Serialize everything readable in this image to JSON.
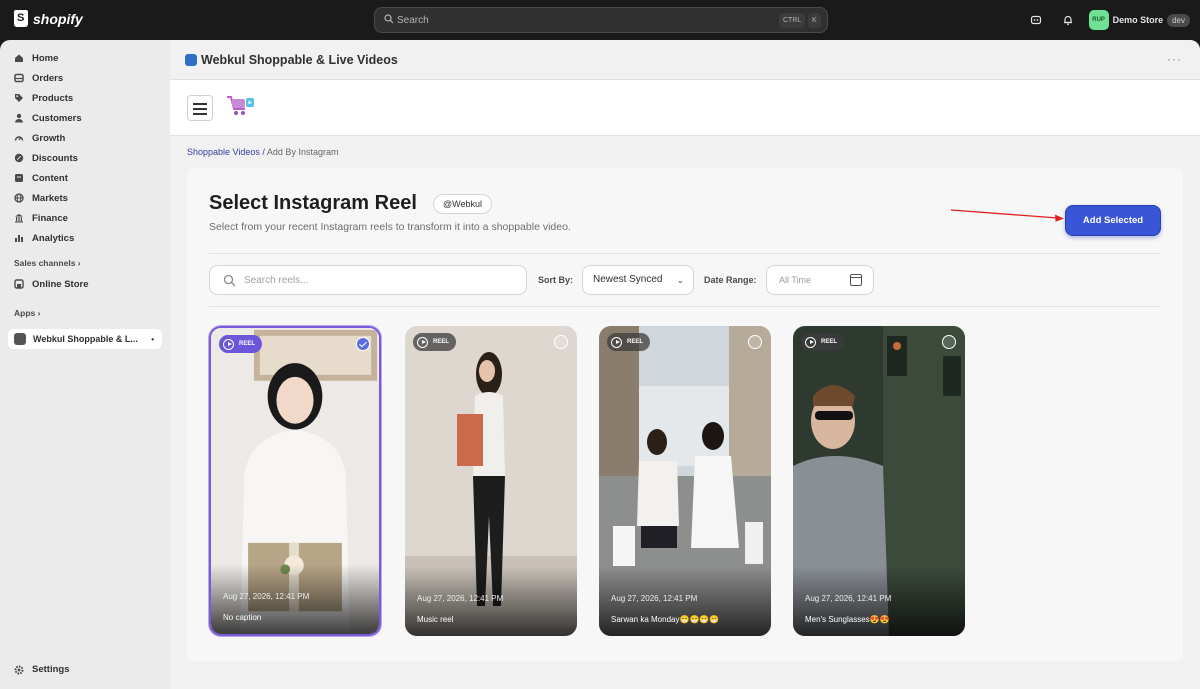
{
  "topbar": {
    "brand": "shopify",
    "search_placeholder": "Search",
    "shortcut_ctrl": "CTRL",
    "shortcut_k": "K",
    "store_initials": "RUP",
    "store_name": "Demo Store",
    "store_badge": "dev"
  },
  "sidebar": {
    "items": [
      {
        "label": "Home",
        "icon": "home-icon"
      },
      {
        "label": "Orders",
        "icon": "orders-icon"
      },
      {
        "label": "Products",
        "icon": "tag-icon"
      },
      {
        "label": "Customers",
        "icon": "person-icon"
      },
      {
        "label": "Growth",
        "icon": "gauge-icon"
      },
      {
        "label": "Discounts",
        "icon": "discount-icon"
      },
      {
        "label": "Content",
        "icon": "content-icon"
      },
      {
        "label": "Markets",
        "icon": "globe-icon"
      },
      {
        "label": "Finance",
        "icon": "bank-icon"
      },
      {
        "label": "Analytics",
        "icon": "bar-chart-icon"
      }
    ],
    "sales_channels_label": "Sales channels",
    "online_store_label": "Online Store",
    "apps_label": "Apps",
    "active_app_label": "Webkul Shoppable & L...",
    "settings_label": "Settings"
  },
  "app": {
    "title": "Webkul Shoppable & Live Videos",
    "more": "···"
  },
  "breadcrumb": {
    "parent": "Shoppable Videos /",
    "current": "Add By Instagram"
  },
  "page": {
    "title": "Select Instagram Reel",
    "handle": "@Webkul",
    "subtitle": "Select from your recent Instagram reels to transform it into a shoppable video.",
    "add_button": "Add Selected",
    "search_placeholder": "Search reels...",
    "sort_label": "Sort By:",
    "sort_value": "Newest Synced",
    "range_label": "Date Range:",
    "range_value": "All Time"
  },
  "reels": [
    {
      "badge": "REEL",
      "date": "Aug 27, 2026, 12:41 PM",
      "caption": "No caption",
      "selected": true
    },
    {
      "badge": "REEL",
      "date": "Aug 27, 2026, 12:41 PM",
      "caption": "Music reel",
      "selected": false
    },
    {
      "badge": "REEL",
      "date": "Aug 27, 2026, 12:41 PM",
      "caption": "Sarwan ka Monday😁😁😁😁",
      "selected": false
    },
    {
      "badge": "REEL",
      "date": "Aug 27, 2026, 12:41 PM",
      "caption": "Men's Sunglasses😍😍",
      "selected": false
    }
  ],
  "colors": {
    "accent": "#3a56d8",
    "selected_border": "#7b5ad8",
    "arrow": "#e02020"
  }
}
